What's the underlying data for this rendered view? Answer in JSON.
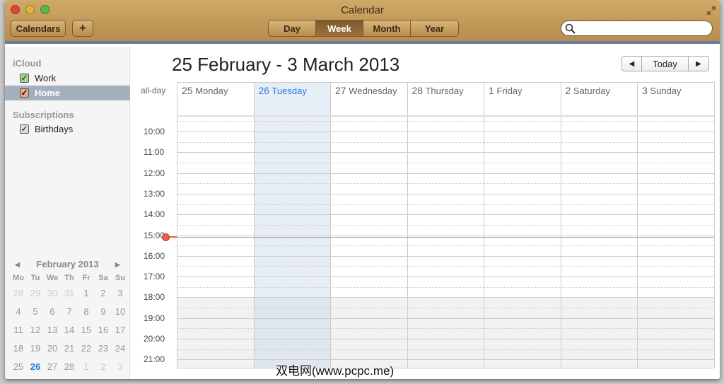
{
  "window": {
    "title": "Calendar"
  },
  "toolbar": {
    "calendars": "Calendars",
    "add": "+",
    "views": [
      "Day",
      "Week",
      "Month",
      "Year"
    ],
    "active_view": "Week",
    "search_placeholder": ""
  },
  "sidebar": {
    "icloud": "iCloud",
    "items": [
      {
        "label": "Work",
        "color": "#5aa33c",
        "checked": true
      },
      {
        "label": "Home",
        "color": "#e07a55",
        "checked": true,
        "selected": true
      }
    ],
    "subscriptions": "Subscriptions",
    "sub_items": [
      {
        "label": "Birthdays",
        "color": "#888888",
        "checked": true
      }
    ]
  },
  "mini_cal": {
    "title": "February 2013",
    "prev": "◀",
    "next": "▶",
    "dow": [
      "Mo",
      "Tu",
      "We",
      "Th",
      "Fr",
      "Sa",
      "Su"
    ],
    "weeks": [
      [
        "28",
        "29",
        "30",
        "31",
        "1",
        "2",
        "3"
      ],
      [
        "4",
        "5",
        "6",
        "7",
        "8",
        "9",
        "10"
      ],
      [
        "11",
        "12",
        "13",
        "14",
        "15",
        "16",
        "17"
      ],
      [
        "18",
        "19",
        "20",
        "21",
        "22",
        "23",
        "24"
      ],
      [
        "25",
        "26",
        "27",
        "28",
        "1",
        "2",
        "3"
      ]
    ],
    "today": "26"
  },
  "main": {
    "title": "25 February - 3 March 2013",
    "prev": "◀",
    "today": "Today",
    "next": "▶",
    "allday": "all-day",
    "days": [
      {
        "num": "25",
        "name": "Monday"
      },
      {
        "num": "26",
        "name": "Tuesday",
        "today": true
      },
      {
        "num": "27",
        "name": "Wednesday"
      },
      {
        "num": "28",
        "name": "Thursday"
      },
      {
        "num": "1",
        "name": "Friday"
      },
      {
        "num": "2",
        "name": "Saturday"
      },
      {
        "num": "3",
        "name": "Sunday"
      }
    ],
    "hours": [
      "10:00",
      "11:00",
      "12:00",
      "13:00",
      "14:00",
      "15:00",
      "16:00",
      "17:00",
      "18:00",
      "19:00",
      "20:00",
      "21:00"
    ],
    "current_time_hour": 15.08,
    "evening_start_hour": 18,
    "accent": "#2a7ce0"
  },
  "watermark": "双电网(www.pcpc.me)"
}
